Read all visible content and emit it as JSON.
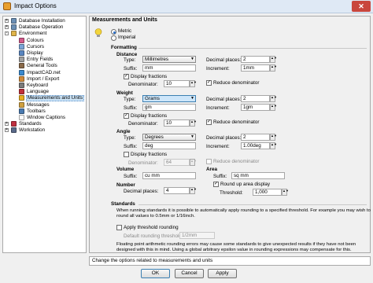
{
  "window": {
    "title": "Impact Options",
    "close_glyph": "✕"
  },
  "tree": [
    {
      "label": "Database Installation",
      "level": 1,
      "expander": "+",
      "icon": "database-icon",
      "color": "#6b8fb5"
    },
    {
      "label": "Database Operation",
      "level": 1,
      "expander": "+",
      "icon": "database-icon",
      "color": "#6b8fb5"
    },
    {
      "label": "Environment",
      "level": 1,
      "expander": "-",
      "icon": "folder-icon",
      "color": "#e0b44a"
    },
    {
      "label": "Colours",
      "level": 2,
      "icon": "palette-icon",
      "color": "#d25a8a"
    },
    {
      "label": "Cursors",
      "level": 2,
      "icon": "cursor-icon",
      "color": "#7aa4d6"
    },
    {
      "label": "Display",
      "level": 2,
      "icon": "display-icon",
      "color": "#5a86c0"
    },
    {
      "label": "Entry Fields",
      "level": 2,
      "icon": "entry-fields-icon",
      "color": "#a0a0a0"
    },
    {
      "label": "General Tools",
      "level": 2,
      "icon": "tools-icon",
      "color": "#8a6a4a"
    },
    {
      "label": "ImpactCAD.net",
      "level": 2,
      "icon": "globe-icon",
      "color": "#3a8ad0"
    },
    {
      "label": "Import / Export",
      "level": 2,
      "icon": "import-export-icon",
      "color": "#d08a3a"
    },
    {
      "label": "Keyboard",
      "level": 2,
      "icon": "keyboard-icon",
      "color": "#7a7a7a"
    },
    {
      "label": "Language",
      "level": 2,
      "icon": "language-icon",
      "color": "#c0303a"
    },
    {
      "label": "Measurements and Units",
      "level": 2,
      "icon": "ruler-icon",
      "color": "#e8b020",
      "selected": true
    },
    {
      "label": "Messages",
      "level": 2,
      "icon": "messages-icon",
      "color": "#d0a040"
    },
    {
      "label": "Toolbars",
      "level": 2,
      "icon": "toolbars-icon",
      "color": "#4a7ab0"
    },
    {
      "label": "Window Captions",
      "level": 2,
      "icon": "window-icon",
      "color": "#fafafa"
    },
    {
      "label": "Standards",
      "level": 1,
      "expander": "+",
      "icon": "flag-icon",
      "color": "#c03040"
    },
    {
      "label": "Workstation",
      "level": 1,
      "expander": "+",
      "icon": "workstation-icon",
      "color": "#5a6a8a"
    }
  ],
  "panel": {
    "heading": "Measurements and Units",
    "system": {
      "metric": "Metric",
      "imperial": "Imperial",
      "selected": "Metric"
    },
    "formatting_label": "Formatting",
    "distance": {
      "title": "Distance",
      "type_label": "Type:",
      "type_value": "Millimetres",
      "suffix_label": "Suffix:",
      "suffix_value": "mm",
      "display_fractions": "Display fractions",
      "denominator_label": "Denominator:",
      "denominator_value": "10",
      "decimal_label": "Decimal places:",
      "decimal_value": "2",
      "increment_label": "Increment:",
      "increment_value": "1mm",
      "reduce_label": "Reduce denominator"
    },
    "weight": {
      "title": "Weight",
      "type_label": "Type:",
      "type_value": "Grams",
      "suffix_label": "Suffix:",
      "suffix_value": "gm",
      "display_fractions": "Display fractions",
      "denominator_label": "Denominator:",
      "denominator_value": "10",
      "decimal_label": "Decimal places:",
      "decimal_value": "2",
      "increment_label": "Increment:",
      "increment_value": "1gm",
      "reduce_label": "Reduce denominator"
    },
    "angle": {
      "title": "Angle",
      "type_label": "Type:",
      "type_value": "Degrees",
      "suffix_label": "Suffix:",
      "suffix_value": "deg",
      "display_fractions": "Display fractions",
      "denominator_label": "Denominator:",
      "denominator_value": "64",
      "decimal_label": "Decimal places:",
      "decimal_value": "2",
      "increment_label": "Increment:",
      "increment_value": "1.00deg",
      "reduce_label": "Reduce denominator"
    },
    "volume": {
      "title": "Volume",
      "suffix_label": "Suffix:",
      "suffix_value": "cu mm"
    },
    "area": {
      "title": "Area",
      "suffix_label": "Suffix:",
      "suffix_value": "sq mm",
      "round_up_label": "Round up area display",
      "threshold_label": "Threshold:",
      "threshold_value": "1,000"
    },
    "number": {
      "title": "Number",
      "decimal_label": "Decimal places:",
      "decimal_value": "4"
    },
    "standards": {
      "title": "Standards",
      "info_line1": "When running standards it is possible to automatically apply rounding to a specified threshold. For example you may wish to",
      "info_line2": "round all values to 0.5mm or 1/16inch.",
      "apply_label": "Apply threshold rounding",
      "default_label": "Default rounding threshold:",
      "default_value": "1/2mm",
      "warn_line1": "Floating point arithmetic rounding errors may cause some standards to give unexpected results if they have not been",
      "warn_line2": "designed with this in mind. Using a global arbitrary epsilon value in rounding expressions may compensate for this."
    }
  },
  "status": "Change the options related to measurements and units",
  "buttons": {
    "ok": "OK",
    "cancel": "Cancel",
    "apply": "Apply"
  },
  "glyphs": {
    "check": "✓",
    "spin": "▲▼",
    "dropdown": "▼"
  }
}
